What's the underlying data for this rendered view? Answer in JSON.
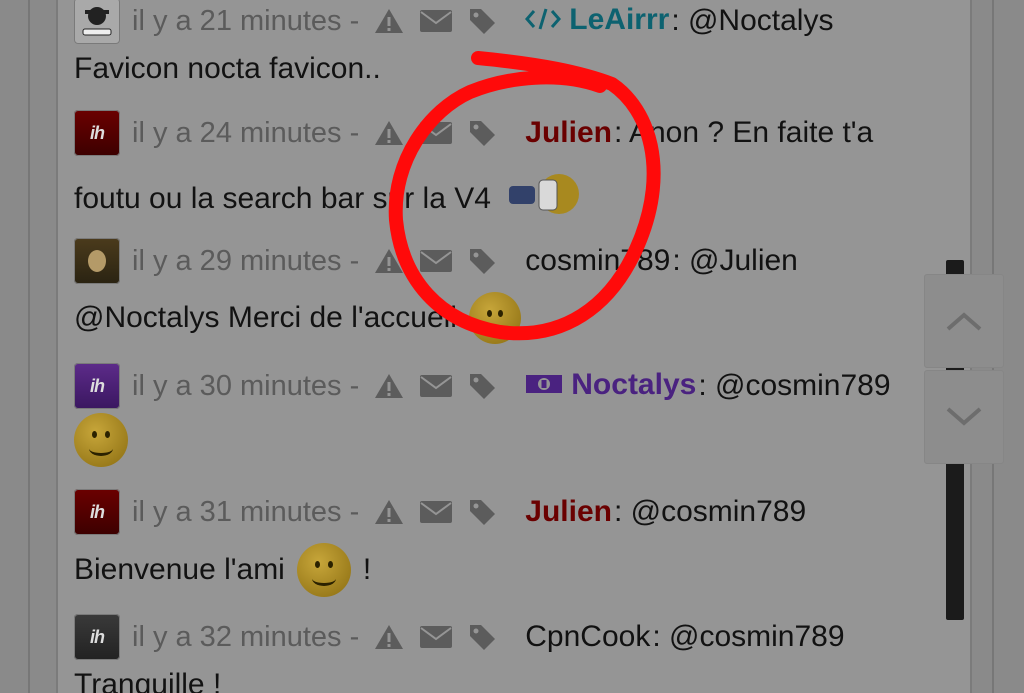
{
  "messages": [
    {
      "time": "il y a 21 minutes -",
      "user": "LeAirrr",
      "user_badge": "code",
      "body_inline": ": @Noctalys",
      "body": "Favicon nocta favicon.."
    },
    {
      "time": "il y a 24 minutes -",
      "user": "Julien",
      "body_inline": ": Anon ? En faite t'a",
      "body": "foutu ou la search bar sur la V4"
    },
    {
      "time": "il y a 29 minutes -",
      "user": "cosmin789",
      "body_inline": ": @Julien",
      "body": "@Noctalys Merci de l'accueil"
    },
    {
      "time": "il y a 30 minutes -",
      "user": "Noctalys",
      "user_badge": "money",
      "body_inline": ": @cosmin789",
      "body": ""
    },
    {
      "time": "il y a 31 minutes -",
      "user": "Julien",
      "body_inline": ": @cosmin789",
      "body": "Bienvenue l'ami",
      "body_after": "!"
    },
    {
      "time": "il y a 32 minutes -",
      "user": "CpnCook",
      "body_inline": ": @cosmin789",
      "body": "Tranquille !"
    }
  ],
  "icons": [
    "warning-icon",
    "envelope-icon",
    "tag-icon",
    "smiley-icon",
    "chevron-up-icon",
    "chevron-down-icon"
  ],
  "colors": {
    "teal_user": "#0d6270",
    "red_user": "#6a0000",
    "purple_user": "#4a2280",
    "annotation": "#ff0a0a"
  }
}
